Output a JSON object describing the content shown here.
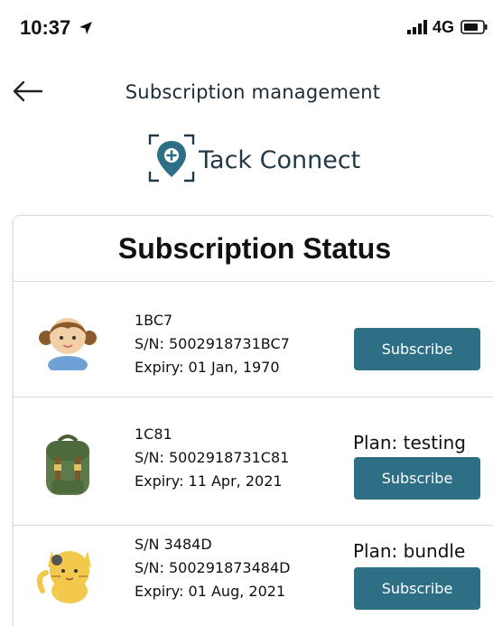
{
  "status_bar": {
    "time": "10:37",
    "network": "4G"
  },
  "header": {
    "title": "Subscription management"
  },
  "brand": {
    "name": "Tack Connect",
    "color": "#2f6f86"
  },
  "card": {
    "title": "Subscription Status"
  },
  "devices": [
    {
      "avatar": "girl-avatar-icon",
      "name": "1BC7",
      "serial": "S/N: 5002918731BC7",
      "expiry": "Expiry: 01 Jan, 1970",
      "plan": "",
      "button": "Subscribe"
    },
    {
      "avatar": "backpack-icon",
      "name": "1C81",
      "serial": "S/N: 5002918731C81",
      "expiry": "Expiry: 11 Apr, 2021",
      "plan": "Plan: testing",
      "button": "Subscribe"
    },
    {
      "avatar": "cat-icon",
      "name": "S/N 3484D",
      "serial": "S/N: 500291873484D",
      "expiry": "Expiry: 01 Aug, 2021",
      "plan": "Plan: bundle",
      "button": "Subscribe"
    }
  ],
  "colors": {
    "button": "#2f6f86",
    "title": "#1e2a36"
  }
}
